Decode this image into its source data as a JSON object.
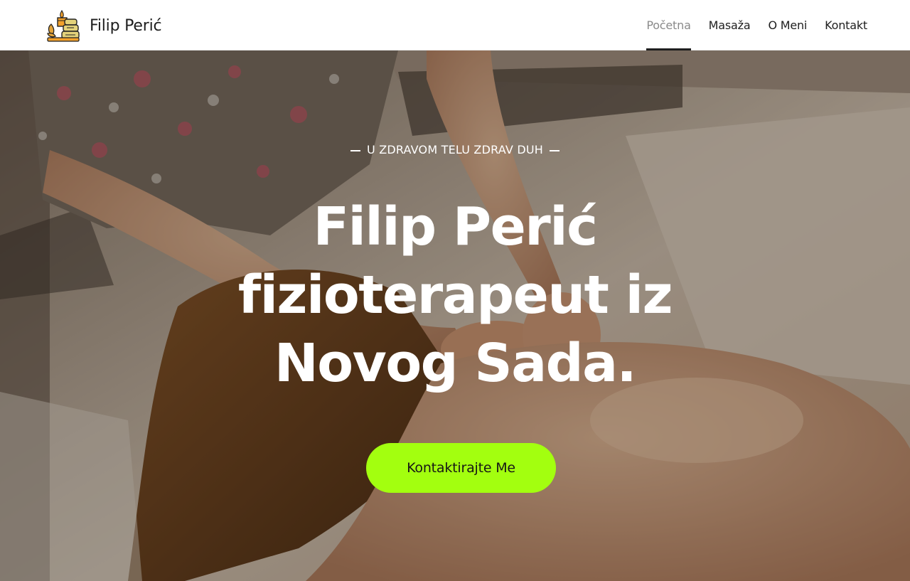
{
  "header": {
    "brand_name": "Filip Perić",
    "logo_icon": "candle-and-stones-icon",
    "nav": [
      {
        "label": "Početna",
        "active": true
      },
      {
        "label": "Masaža",
        "active": false
      },
      {
        "label": "O Meni",
        "active": false
      },
      {
        "label": "Kontakt",
        "active": false
      }
    ]
  },
  "hero": {
    "tagline": "U ZDRAVOM TELU ZDRAV DUH",
    "heading_lines": [
      "Filip Perić",
      "fizioterapeut iz",
      "Novog Sada."
    ],
    "cta_label": "Kontaktirajte Me",
    "background_image": "massage-photo"
  },
  "colors": {
    "accent": "#a3ff0f",
    "text_dark": "#1e1e1e",
    "nav_active": "#8a8a8a"
  }
}
